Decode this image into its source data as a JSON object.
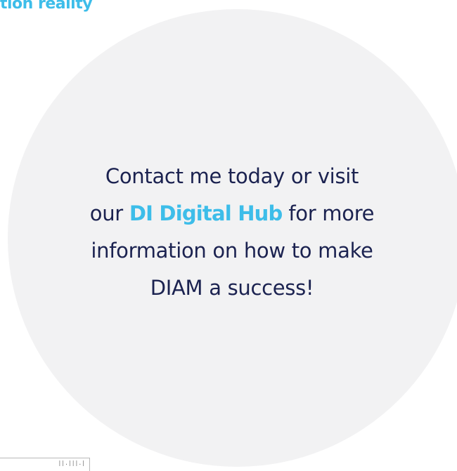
{
  "heading": {
    "fragment": "tion reality"
  },
  "message": {
    "line1": "Contact me today or visit",
    "line2_before": "our ",
    "link_label": "DI Digital Hub",
    "line2_after": " for more",
    "line3": "information on how to make",
    "line4": "DIAM a success!"
  },
  "corner_box": {
    "text": "||.|||.|"
  },
  "colors": {
    "accent": "#3dbde9",
    "text": "#1b2250",
    "circle": "#f2f2f3"
  }
}
